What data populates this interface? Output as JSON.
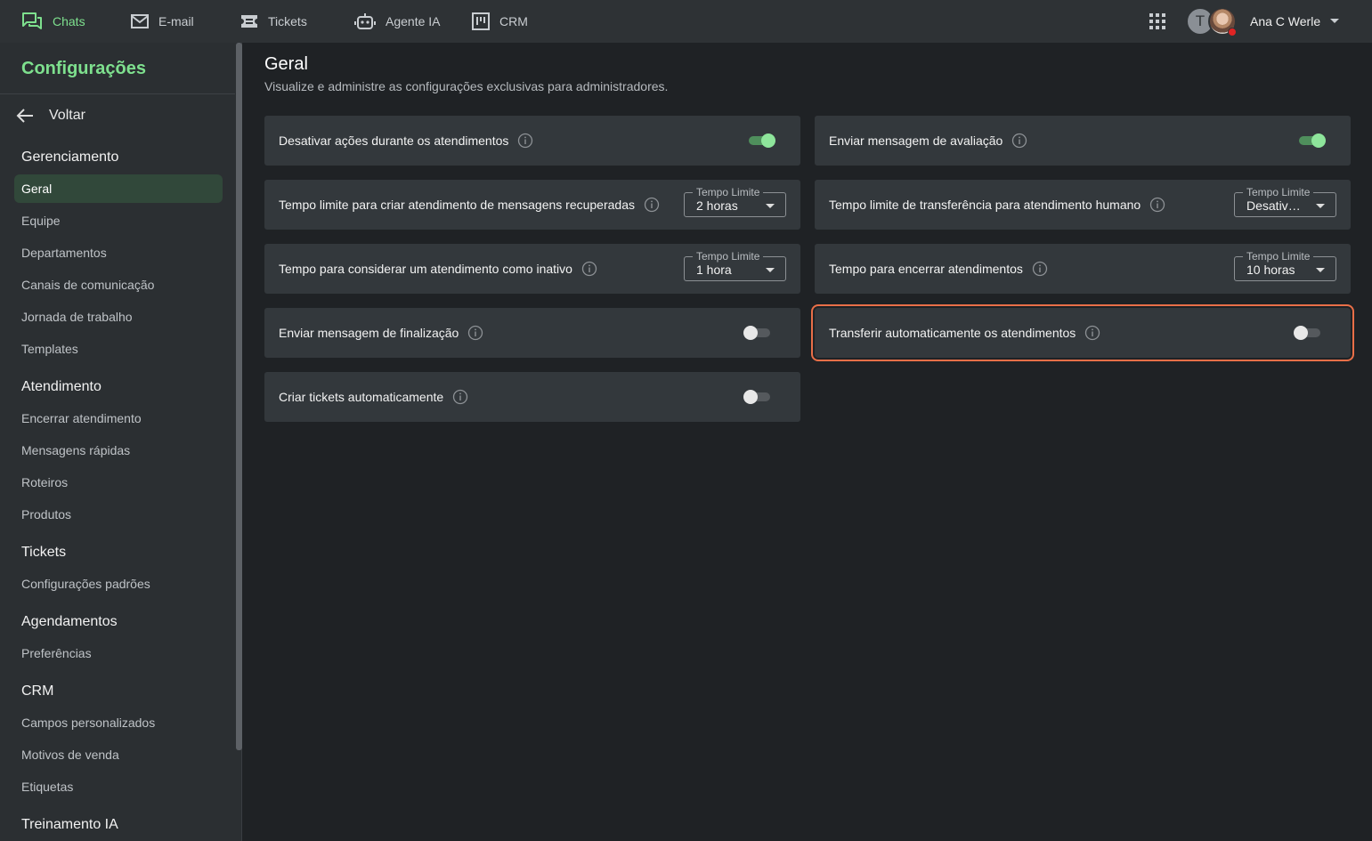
{
  "topnav": {
    "items": [
      {
        "label": "Chats",
        "icon": "chat-icon",
        "active": true
      },
      {
        "label": "E-mail",
        "icon": "mail-icon"
      },
      {
        "label": "Tickets",
        "icon": "ticket-icon"
      },
      {
        "label": "Agente IA",
        "icon": "robot-icon"
      },
      {
        "label": "CRM",
        "icon": "kanban-icon"
      }
    ],
    "avatar_letter": "T",
    "user_name": "Ana C Werle"
  },
  "sidebar": {
    "title": "Configurações",
    "back_label": "Voltar",
    "sections": [
      {
        "heading": "Gerenciamento",
        "items": [
          "Geral",
          "Equipe",
          "Departamentos",
          "Canais de comunicação",
          "Jornada de trabalho",
          "Templates"
        ]
      },
      {
        "heading": "Atendimento",
        "items": [
          "Encerrar atendimento",
          "Mensagens rápidas",
          "Roteiros",
          "Produtos"
        ]
      },
      {
        "heading": "Tickets",
        "items": [
          "Configurações padrões"
        ]
      },
      {
        "heading": "Agendamentos",
        "items": [
          "Preferências"
        ]
      },
      {
        "heading": "CRM",
        "items": [
          "Campos personalizados",
          "Motivos de venda",
          "Etiquetas"
        ]
      },
      {
        "heading": "Treinamento IA",
        "items": []
      }
    ],
    "active_item": "Geral"
  },
  "main": {
    "title": "Geral",
    "subtitle": "Visualize e administre as configurações exclusivas para administradores.",
    "settings": [
      {
        "label": "Desativar ações durante os atendimentos",
        "control": "toggle",
        "on": true
      },
      {
        "label": "Enviar mensagem de avaliação",
        "control": "toggle",
        "on": true
      },
      {
        "label": "Tempo limite para criar atendimento de mensagens recuperadas",
        "control": "select",
        "legend": "Tempo Limite",
        "value": "2 horas"
      },
      {
        "label": "Tempo limite de transferência para atendimento humano",
        "control": "select",
        "legend": "Tempo Limite",
        "value": "Desativado"
      },
      {
        "label": "Tempo para considerar um atendimento como inativo",
        "control": "select",
        "legend": "Tempo Limite",
        "value": "1 hora"
      },
      {
        "label": "Tempo para encerrar atendimentos",
        "control": "select",
        "legend": "Tempo Limite",
        "value": "10 horas"
      },
      {
        "label": "Enviar mensagem de finalização",
        "control": "toggle",
        "on": false
      },
      {
        "label": "Transferir automaticamente os atendimentos",
        "control": "toggle",
        "on": false,
        "highlighted": true
      },
      {
        "label": "Criar tickets automaticamente",
        "control": "toggle",
        "on": false
      }
    ]
  },
  "colors": {
    "accent": "#7ee08e",
    "highlight_border": "#e96f48",
    "status_dot": "#e02424"
  }
}
